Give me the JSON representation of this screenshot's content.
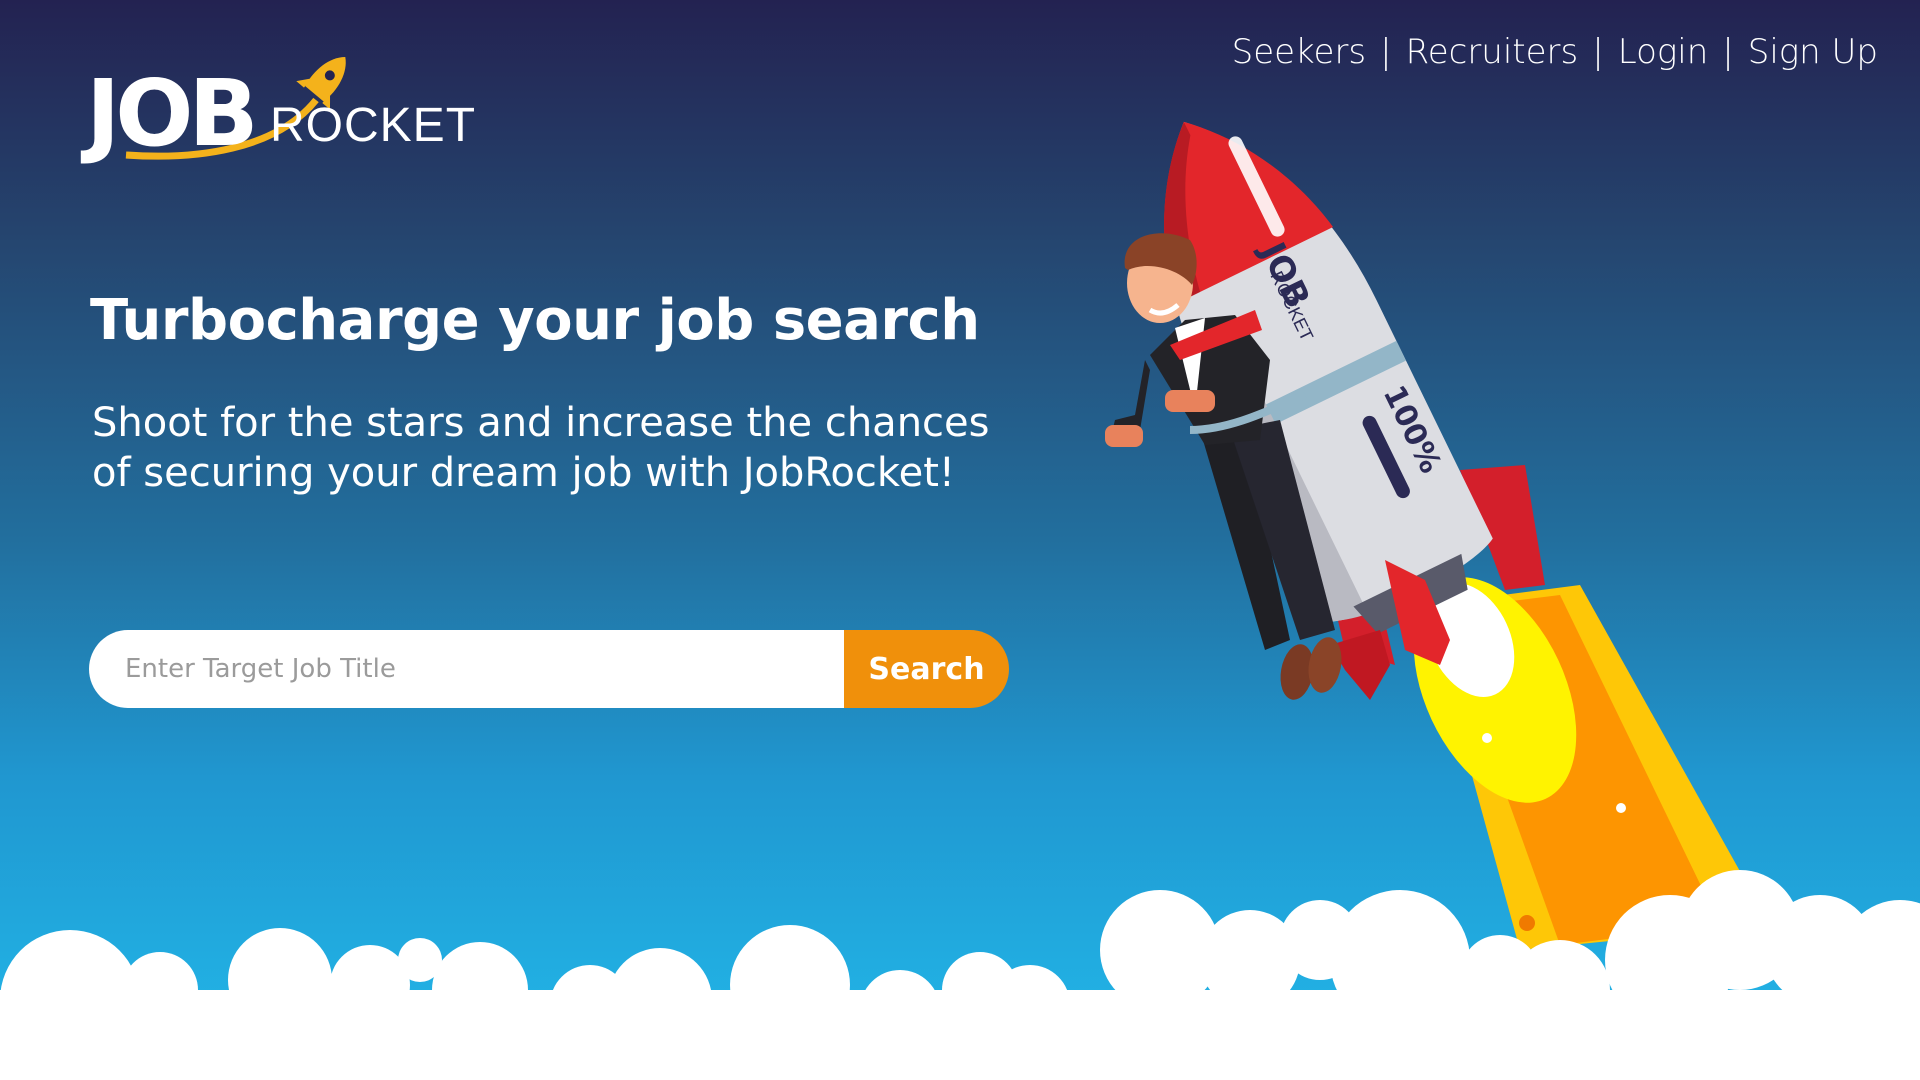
{
  "brand": {
    "logo_job": "JOB",
    "logo_rocket": "ROCKET"
  },
  "nav": {
    "items": [
      {
        "label": "Seekers"
      },
      {
        "label": "Recruiters"
      },
      {
        "label": "Login"
      },
      {
        "label": "Sign Up"
      }
    ],
    "separator": "|"
  },
  "hero": {
    "title": "Turbocharge your job search",
    "subtitle": "Shoot for the stars and increase the chances of securing your dream job with JobRocket!"
  },
  "search": {
    "placeholder": "Enter Target Job Title",
    "button_label": "Search"
  },
  "illustration": {
    "rocket_brand_job": "JOB",
    "rocket_brand_rocket": "ROCKET",
    "rocket_progress": "100%",
    "icons": [
      "rocket-icon",
      "businessman-illustration",
      "cloud-illustration"
    ]
  },
  "colors": {
    "accent": "#f0900b",
    "logo_gold": "#f4b21b",
    "rocket_red": "#e3262b",
    "rocket_body": "#dcdde2",
    "background_top": "#232251",
    "background_bottom": "#22b9ea"
  }
}
